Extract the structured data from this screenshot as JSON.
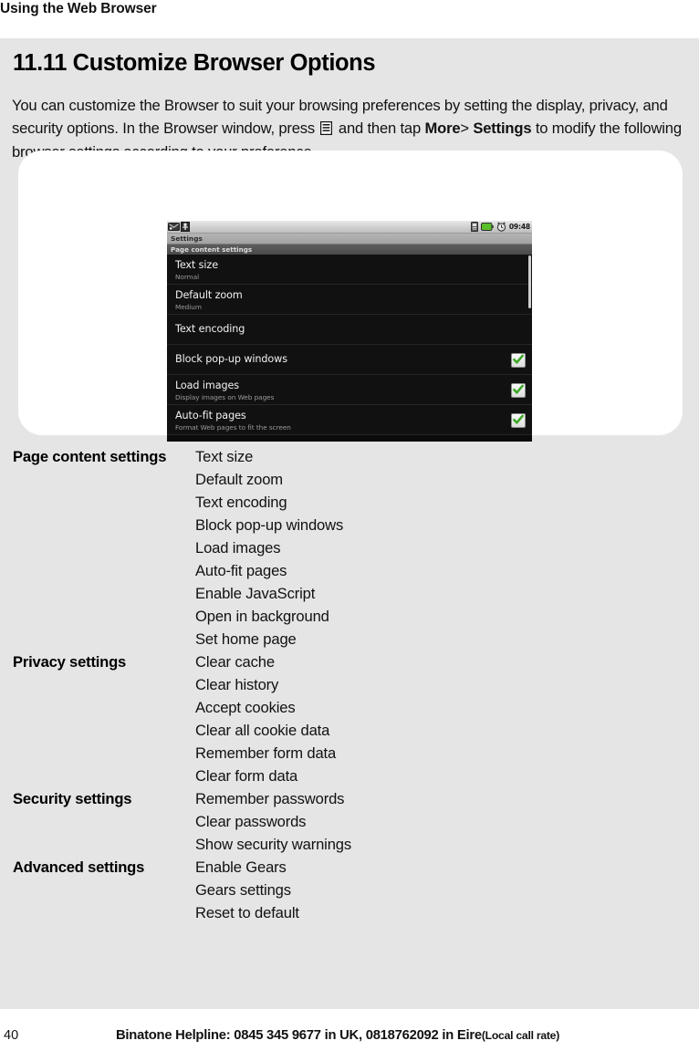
{
  "header": {
    "running_head": "Using the Web Browser"
  },
  "section": {
    "title": "11.11 Customize Browser Options",
    "intro_part1": "You can customize the Browser to suit your browsing preferences by setting the display, privacy, and security options. In the Browser window, press",
    "menu_icon_name": "menu-icon",
    "intro_part2": "and then tap",
    "bold_more": "More",
    "gt": ">",
    "bold_settings": "Settings",
    "intro_part3": "to modify the following browser settings according to your preference."
  },
  "figure": {
    "device": {
      "status_bar": {
        "left_icons": [
          "mms-message-icon",
          "usb-debugging-icon"
        ],
        "right_icons": [
          "sim-card-icon",
          "battery-icon",
          "alarm-clock-icon"
        ],
        "clock": "09:48",
        "battery_color": "#5bbf2a"
      },
      "title_bar": "Settings",
      "category_header": "Page content settings",
      "rows": [
        {
          "title": "Text size",
          "subtitle": "Normal",
          "checkbox": false
        },
        {
          "title": "Default zoom",
          "subtitle": "Medium",
          "checkbox": false
        },
        {
          "title": "Text encoding",
          "subtitle": "",
          "checkbox": false
        },
        {
          "title": "Block pop-up windows",
          "subtitle": "",
          "checkbox": true
        },
        {
          "title": "Load images",
          "subtitle": "Display images on Web pages",
          "checkbox": true
        },
        {
          "title": "Auto-fit pages",
          "subtitle": "Format Web pages to fit the screen",
          "checkbox": true
        }
      ],
      "checkmark_color": "#3ea828"
    }
  },
  "settings_reference": [
    {
      "label": "Page content settings",
      "items": [
        "Text size",
        "Default zoom",
        "Text encoding",
        "Block pop-up windows",
        "Load images",
        "Auto-fit pages",
        "Enable JavaScript",
        "Open in background",
        "Set home page"
      ]
    },
    {
      "label": "Privacy settings",
      "items": [
        "Clear cache",
        "Clear history",
        "Accept cookies",
        "Clear all cookie data",
        "Remember form data",
        "Clear form data"
      ]
    },
    {
      "label": "Security settings",
      "items": [
        "Remember passwords",
        "Clear passwords",
        "Show security warnings"
      ]
    },
    {
      "label": "Advanced settings",
      "items": [
        "Enable Gears",
        "Gears settings",
        "Reset to default"
      ]
    }
  ],
  "footer": {
    "page_number": "40",
    "helpline_main": "Binatone Helpline: 0845 345 9677 in UK, 0818762092 in Eire",
    "helpline_rate": "(Local call rate)"
  },
  "colors": {
    "content_background": "#e5e5e5",
    "page_background": "#ffffff",
    "figure_panel": "#ffffff",
    "device_background": "#0b0b0b"
  }
}
